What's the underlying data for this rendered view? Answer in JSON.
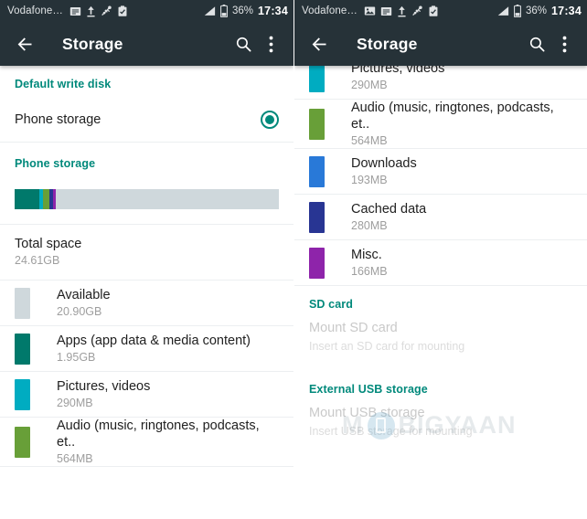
{
  "colors": {
    "accent_teal": "#00897b",
    "statusbar_bg": "#263238",
    "apps": "#00796b",
    "pictures": "#00acc1",
    "audio": "#689f38",
    "downloads": "#2979d8",
    "cached": "#283593",
    "misc": "#8e24aa",
    "available": "#cfd8dc"
  },
  "statusbar": {
    "carrier": "Vodafone…",
    "battery_percent": "36%",
    "time": "17:34",
    "icons_left": [
      "message-icon",
      "upload-icon",
      "usb-debug-icon",
      "clipboard-check-icon"
    ],
    "icons_left_right_panel": [
      "image-icon",
      "message-icon",
      "upload-icon",
      "usb-debug-icon",
      "clipboard-check-icon"
    ],
    "icons_right": [
      "signal-icon",
      "battery-icon"
    ]
  },
  "appbar": {
    "title": "Storage",
    "back_icon": "back-arrow-icon",
    "search_icon": "search-icon",
    "overflow_icon": "overflow-menu-icon"
  },
  "left_panel": {
    "default_write_disk_header": "Default write disk",
    "write_disk_option": {
      "label": "Phone storage",
      "selected": true
    },
    "phone_storage_header": "Phone storage",
    "storage_bar": [
      {
        "name": "Apps",
        "color": "#00796b",
        "percent": 9.3
      },
      {
        "name": "Pictures, videos",
        "color": "#00acc1",
        "percent": 1.4
      },
      {
        "name": "Audio",
        "color": "#689f38",
        "percent": 2.6
      },
      {
        "name": "Cached data",
        "color": "#283593",
        "percent": 1.3
      },
      {
        "name": "Misc.",
        "color": "#8e24aa",
        "percent": 1.1
      },
      {
        "name": "Available",
        "color": "#cfd8dc",
        "percent": 84.3
      }
    ],
    "total_space": {
      "label": "Total space",
      "value": "24.61GB"
    },
    "items": [
      {
        "label": "Available",
        "value": "20.90GB",
        "color": "#cfd8dc"
      },
      {
        "label": "Apps (app data & media content)",
        "value": "1.95GB",
        "color": "#00796b"
      },
      {
        "label": "Pictures, videos",
        "value": "290MB",
        "color": "#00acc1"
      },
      {
        "label": "Audio (music, ringtones, podcasts, et..",
        "value": "564MB",
        "color": "#689f38"
      }
    ]
  },
  "right_panel": {
    "items": [
      {
        "label": "Pictures, videos",
        "value": "290MB",
        "color": "#00acc1"
      },
      {
        "label": "Audio (music, ringtones, podcasts, et..",
        "value": "564MB",
        "color": "#689f38"
      },
      {
        "label": "Downloads",
        "value": "193MB",
        "color": "#2979d8"
      },
      {
        "label": "Cached data",
        "value": "280MB",
        "color": "#283593"
      },
      {
        "label": "Misc.",
        "value": "166MB",
        "color": "#8e24aa"
      }
    ],
    "sd_card_header": "SD card",
    "sd_card_mount": {
      "title": "Mount SD card",
      "subtitle": "Insert an SD card for mounting"
    },
    "usb_header": "External USB storage",
    "usb_mount": {
      "title": "Mount USB storage",
      "subtitle": "Insert USB storage for mounting"
    },
    "watermark": "MOBIGYAAN"
  }
}
